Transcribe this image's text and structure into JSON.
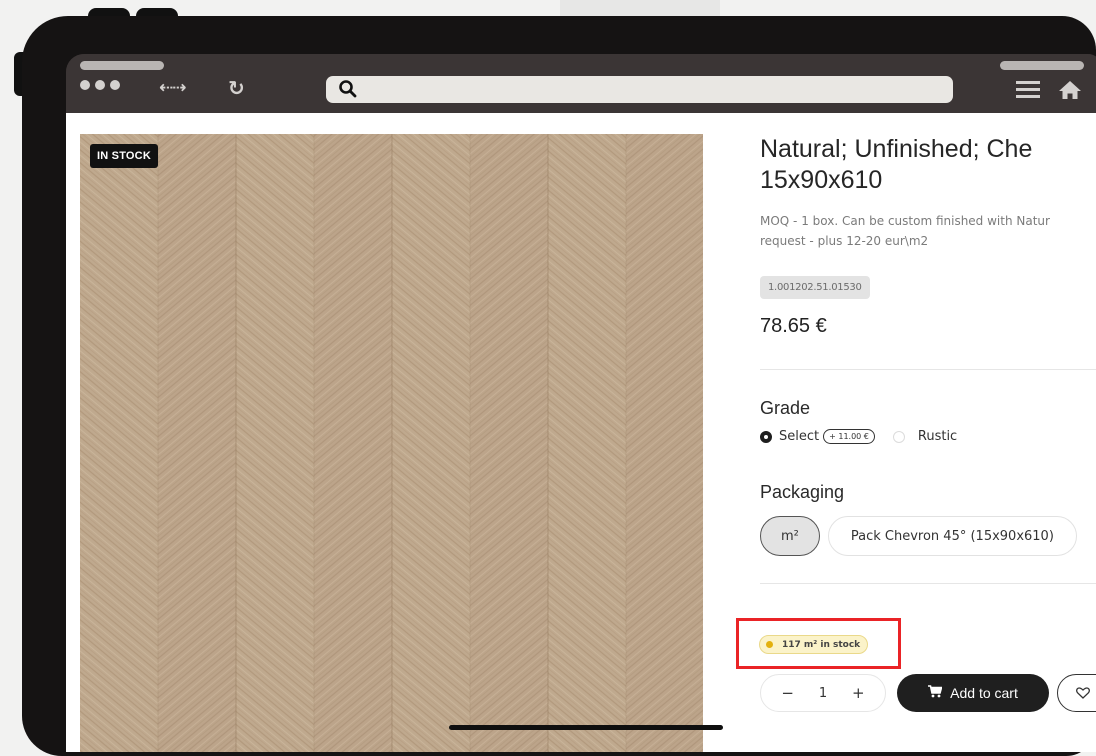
{
  "browser": {
    "nav_arrows": "⇠⇢",
    "reload_glyph": "↻"
  },
  "product": {
    "badge": "IN STOCK",
    "title_line1": "Natural; Unfinished; Che",
    "title_line2": "15x90x610",
    "description_line1": "MOQ - 1 box. Can be custom finished with Natur",
    "description_line2": "request - plus 12-20 eur\\m2",
    "sku": "1.001202.51.01530",
    "price": "78.65 €"
  },
  "grade": {
    "label": "Grade",
    "options": [
      {
        "label": "Select",
        "surcharge": "+ 11.00 €",
        "selected": true
      },
      {
        "label": "Rustic",
        "selected": false
      }
    ]
  },
  "packaging": {
    "label": "Packaging",
    "options": [
      {
        "label": "m²",
        "selected": true
      },
      {
        "label": "Pack Chevron 45° (15x90x610)",
        "selected": false
      }
    ]
  },
  "stock": {
    "text": "117 m² in stock"
  },
  "cart": {
    "minus": "−",
    "quantity": "1",
    "plus": "+",
    "add_label": "Add to cart"
  },
  "colors": {
    "frame": "#151313",
    "chrome": "#3b3535",
    "highlight": "#ea2326",
    "cart_button": "#1f1f1f",
    "stock_dot": "#e3b10f"
  }
}
